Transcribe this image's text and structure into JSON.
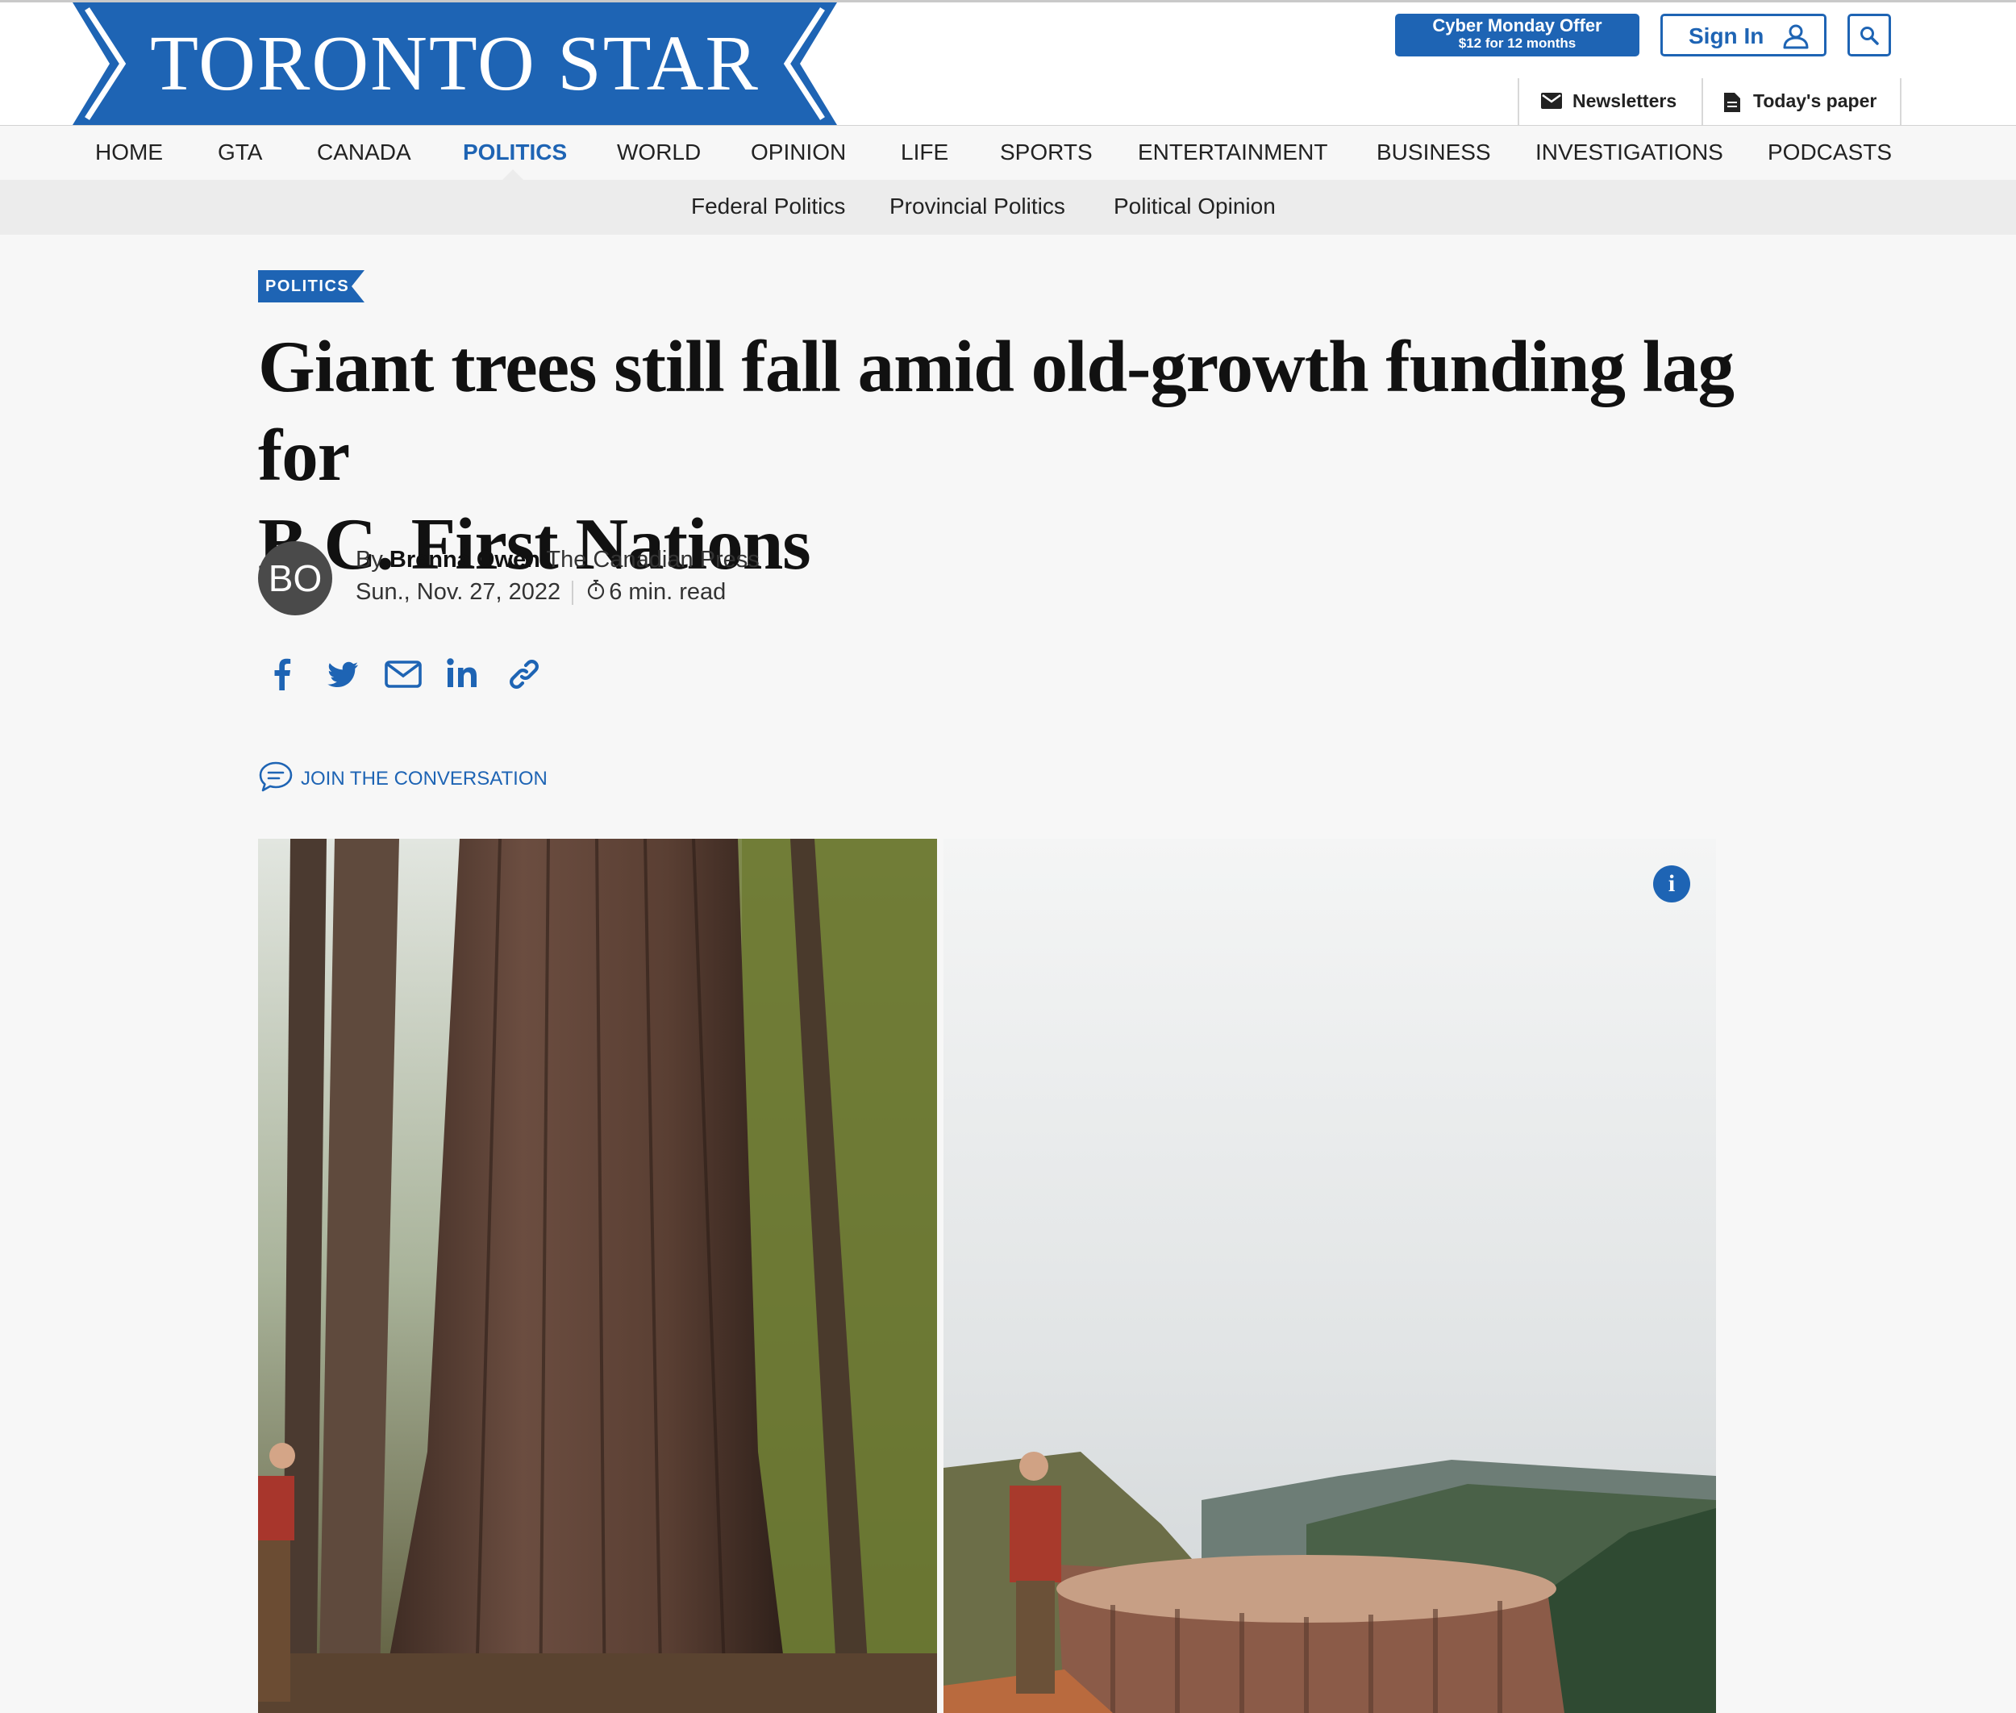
{
  "site": {
    "logo_text": "TORONTO STAR",
    "brand_color": "#1e64b4"
  },
  "header": {
    "promo": {
      "title": "Cyber Monday Offer",
      "subtitle": "$12 for 12 months"
    },
    "signin_label": "Sign In",
    "newsletters_label": "Newsletters",
    "todays_paper_label": "Today's paper"
  },
  "nav": {
    "items": [
      {
        "label": "HOME"
      },
      {
        "label": "GTA"
      },
      {
        "label": "CANADA"
      },
      {
        "label": "POLITICS",
        "active": true
      },
      {
        "label": "WORLD"
      },
      {
        "label": "OPINION"
      },
      {
        "label": "LIFE"
      },
      {
        "label": "SPORTS"
      },
      {
        "label": "ENTERTAINMENT"
      },
      {
        "label": "BUSINESS"
      },
      {
        "label": "INVESTIGATIONS"
      },
      {
        "label": "PODCASTS"
      }
    ],
    "sub_items": [
      {
        "label": "Federal Politics"
      },
      {
        "label": "Provincial Politics"
      },
      {
        "label": "Political Opinion"
      }
    ]
  },
  "article": {
    "section_tag": "POLITICS",
    "headline_line1": "Giant trees still fall amid old-growth funding lag for",
    "headline_line2": "B.C. First Nations",
    "author_initials": "BO",
    "by_prefix": "By",
    "author": "Brenna Owen",
    "outlet": "The Canadian Press",
    "date": "Sun., Nov. 27, 2022",
    "read_time": "6 min. read",
    "join_label": "JOIN THE CONVERSATION",
    "share_icons": [
      "facebook-icon",
      "twitter-icon",
      "email-icon",
      "linkedin-icon",
      "link-icon"
    ],
    "photo_info_glyph": "i"
  }
}
